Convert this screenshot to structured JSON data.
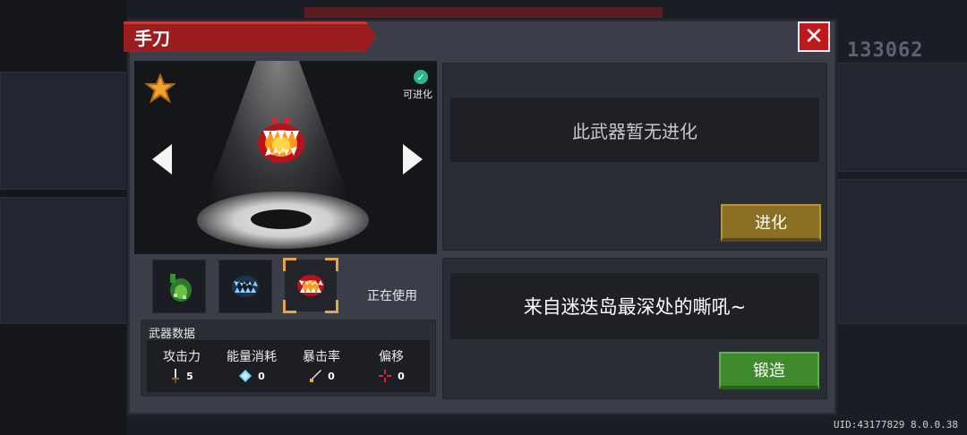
{
  "background": {
    "score": "133062",
    "uid_text": "UID:43177829 8.0.0.38"
  },
  "dialog": {
    "title": "手刀",
    "close_icon": "close-icon"
  },
  "viewer": {
    "star_icon": "star-icon",
    "evolvable_label": "可进化",
    "prev_icon": "arrow-left-icon",
    "next_icon": "arrow-right-icon",
    "weapon_icon": "fanged-mouth-weapon-icon"
  },
  "skins": {
    "items": [
      {
        "name": "green-plant-skin-icon",
        "selected": false
      },
      {
        "name": "ice-fang-skin-icon",
        "selected": false
      },
      {
        "name": "red-fang-skin-icon",
        "selected": true
      }
    ],
    "in_use_label": "正在使用"
  },
  "weapon_stats": {
    "title": "武器数据",
    "stats": [
      {
        "label": "攻击力",
        "value": "5",
        "icon": "sword-icon"
      },
      {
        "label": "能量消耗",
        "value": "0",
        "icon": "energy-crystal-icon"
      },
      {
        "label": "暴击率",
        "value": "0",
        "icon": "crit-icon"
      },
      {
        "label": "偏移",
        "value": "0",
        "icon": "crosshair-icon"
      }
    ]
  },
  "evolution": {
    "status_text": "此武器暂无进化",
    "evolve_button": "进化"
  },
  "description": {
    "text": "来自迷迭岛最深处的嘶吼~",
    "forge_button": "锻造"
  },
  "colors": {
    "title_red": "#9c1d20",
    "close_red": "#c0181c",
    "evolve_gold": "#8b6f24",
    "forge_green": "#3f8a2d",
    "selection_orange": "#e3a646"
  }
}
